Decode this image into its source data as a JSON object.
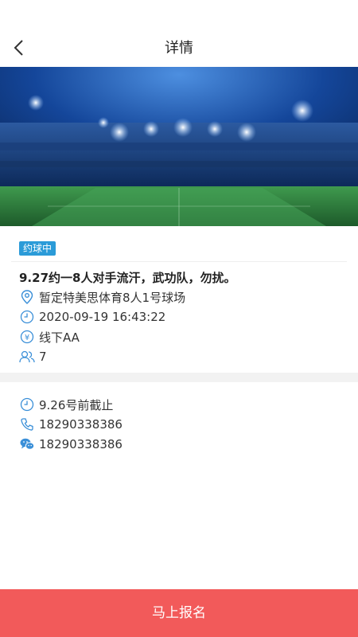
{
  "header": {
    "title": "详情",
    "back_icon": "chevron-left-icon"
  },
  "banner": {
    "image": "football-stadium-night"
  },
  "event": {
    "status": "约球中",
    "title": "9.27约一8人对手流汗，武功队，勿扰。",
    "location": "暂定特美思体育8人1号球场",
    "datetime": "2020-09-19 16:43:22",
    "payment": "线下AA",
    "people": "7"
  },
  "contact": {
    "deadline": "9.26号前截止",
    "phone": "18290338386",
    "wechat": "18290338386"
  },
  "footer": {
    "signup_label": "马上报名"
  },
  "colors": {
    "accent": "#2b9bd8",
    "button": "#f25a5a",
    "icon": "#3a8fd8"
  }
}
